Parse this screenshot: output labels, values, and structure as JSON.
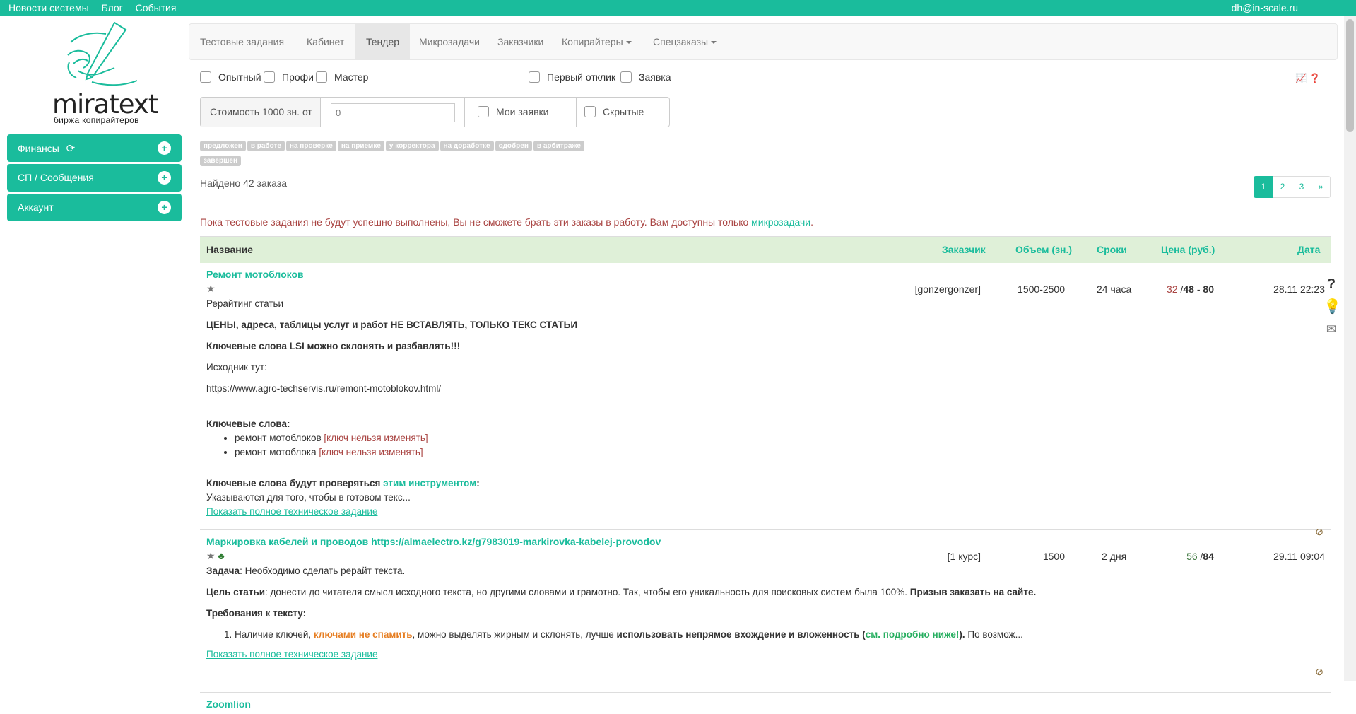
{
  "topbar": {
    "links": [
      "Новости системы",
      "Блог",
      "События"
    ],
    "user": "dh@in-scale.ru"
  },
  "logo": {
    "brand": "miratext",
    "tagline": "биржа копирайтеров"
  },
  "sidebar": {
    "items": [
      {
        "label": "Финансы"
      },
      {
        "label": "СП / Сообщения"
      },
      {
        "label": "Аккаунт"
      }
    ]
  },
  "nav": {
    "items": [
      "Тестовые задания",
      "Кабинет",
      "Тендер",
      "Микрозадачи",
      "Заказчики",
      "Копирайтеры",
      "Спецзаказы"
    ],
    "active": "Тендер"
  },
  "filters": {
    "levels": [
      "Опытный",
      "Профи",
      "Мастер"
    ],
    "first_response": "Первый отклик",
    "request": "Заявка",
    "cost_label": "Стоимость 1000 зн. от",
    "cost_value": "0",
    "my_requests": "Мои заявки",
    "hidden": "Скрытые"
  },
  "statuses": [
    "предложен",
    "в работе",
    "на проверке",
    "на приемке",
    "у корректора",
    "на доработке",
    "одобрен",
    "в арбитраже",
    "завершен"
  ],
  "found_text": "Найдено 42 заказа",
  "pagination": {
    "pages": [
      "1",
      "2",
      "3"
    ],
    "next": "»",
    "current": "1"
  },
  "warning": {
    "text": "Пока тестовые задания не будут успешно выполнены, Вы не сможете брать эти заказы в работу. Вам доступны только ",
    "link": "микрозадачи",
    "end": "."
  },
  "table": {
    "headers": {
      "name": "Название",
      "customer": "Заказчик",
      "volume": "Объем (зн.)",
      "deadline": "Сроки",
      "price": "Цена (руб.)",
      "date": "Дата"
    }
  },
  "orders": [
    {
      "title": "Ремонт мотоблоков",
      "customer": "[gonzergonzer]",
      "volume": "1500-2500",
      "deadline": "24 часа",
      "price_low": "32",
      "price_mid": "48",
      "price_high": "80",
      "date": "28.11 22:23",
      "type": "Рерайтинг статьи",
      "line1": "ЦЕНЫ, адреса, таблицы услуг и работ НЕ ВСТАВЛЯТЬ, ТОЛЬКО ТЕКС СТАТЬИ",
      "line2": "Ключевые слова LSI можно склонять и разбавлять!!!",
      "line3": "Исходник тут:",
      "line4": "https://www.agro-techservis.ru/remont-motoblokov.html/",
      "kw_title": "Ключевые слова:",
      "keywords": [
        {
          "word": "ремонт мотоблоков",
          "note": "[ключ нельзя изменять]"
        },
        {
          "word": "ремонт мотоблока",
          "note": "[ключ нельзя изменять]"
        }
      ],
      "check_prefix": "Ключевые слова будут проверяться ",
      "check_link": "этим инструментом",
      "check_suffix": ":",
      "snippet": "Указываются для того, чтобы в готовом текс...",
      "more": "Показать полное техническое задание"
    },
    {
      "title": "Маркировка кабелей и проводов https://almaelectro.kz/g7983019-markirovka-kabelej-provodov",
      "customer": "[1 курс]",
      "volume": "1500",
      "deadline": "2 дня",
      "price_low": "56",
      "price_high": "84",
      "date": "29.11 09:04",
      "task_label": "Задача",
      "task_text": ": Необходимо сделать рерайт текста.",
      "goal_label": "Цель статьи",
      "goal_text": ": донести до читателя смысл исходного текста, но другими словами и грамотно. Так, чтобы его уникальность для поисковых систем была 100%. ",
      "goal_bold": "Призыв заказать на сайте.",
      "req_title": "Требования к тексту:",
      "req1_a": "Наличие ключей, ",
      "req1_b": "ключами не спамить",
      "req1_c": ", можно выделять жирным и склонять, лучше ",
      "req1_d": "использовать непрямое вхождение и вложенность (",
      "req1_e": "см. подробно ниже!",
      "req1_f": "). ",
      "req1_g": "По возмож...",
      "more": "Показать полное техническое задание"
    },
    {
      "title": "Zoomlion"
    }
  ],
  "colors": {
    "accent": "#1abc9c",
    "header_bg": "#dff0d8",
    "warning": "#a94442"
  }
}
